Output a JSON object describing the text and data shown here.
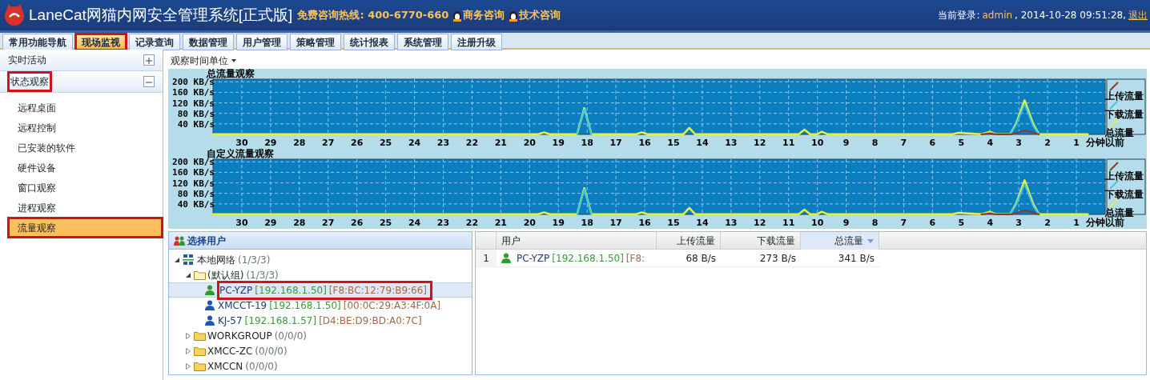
{
  "header": {
    "title": "LaneCat网猫内网安全管理系统[正式版]",
    "hotline": "免费咨询热线: 400-6770-660",
    "contacts": [
      "商务咨询",
      "技术咨询"
    ],
    "login_label": "当前登录:",
    "user": "admin",
    "datetime": ", 2014-10-28 09:51:28,",
    "logout": "退出"
  },
  "tabs": [
    {
      "label": "常用功能导航",
      "selected": false,
      "highlighted": false
    },
    {
      "label": "现场监视",
      "selected": true,
      "highlighted": true
    },
    {
      "label": "记录查询",
      "selected": false,
      "highlighted": false
    },
    {
      "label": "数据管理",
      "selected": false,
      "highlighted": false
    },
    {
      "label": "用户管理",
      "selected": false,
      "highlighted": false
    },
    {
      "label": "策略管理",
      "selected": false,
      "highlighted": false
    },
    {
      "label": "统计报表",
      "selected": false,
      "highlighted": false
    },
    {
      "label": "系统管理",
      "selected": false,
      "highlighted": false
    },
    {
      "label": "注册升级",
      "selected": false,
      "highlighted": false
    }
  ],
  "sidebar": {
    "sections": [
      {
        "title": "实时活动",
        "expanded": false,
        "highlighted": false
      },
      {
        "title": "状态观察",
        "expanded": true,
        "highlighted": true,
        "items": [
          {
            "label": "远程桌面",
            "selected": false,
            "highlighted": false
          },
          {
            "label": "远程控制",
            "selected": false,
            "highlighted": false
          },
          {
            "label": "已安装的软件",
            "selected": false,
            "highlighted": false
          },
          {
            "label": "硬件设备",
            "selected": false,
            "highlighted": false
          },
          {
            "label": "窗口观察",
            "selected": false,
            "highlighted": false
          },
          {
            "label": "进程观察",
            "selected": false,
            "highlighted": false
          },
          {
            "label": "流量观察",
            "selected": true,
            "highlighted": true
          }
        ]
      }
    ]
  },
  "toolbar": {
    "menu": "观察时间单位"
  },
  "charts": [
    {
      "chart_data": {
        "type": "line",
        "title": "总流量观察",
        "xlabel": "分钟以前",
        "xlim": [
          31,
          0
        ],
        "ylim": [
          0,
          210
        ],
        "grid": true,
        "legend": true,
        "xticks": [
          30,
          29,
          28,
          27,
          26,
          25,
          24,
          23,
          22,
          21,
          20,
          19,
          18,
          17,
          16,
          15,
          14,
          13,
          12,
          11,
          10,
          9,
          8,
          7,
          6,
          5,
          4,
          3,
          2,
          1
        ],
        "yticks": [
          {
            "value": 40,
            "label": "40 KB/s"
          },
          {
            "value": 80,
            "label": "80 KB/s"
          },
          {
            "value": 120,
            "label": "120 KB/s"
          },
          {
            "value": 160,
            "label": "160 KB/s"
          },
          {
            "value": 200,
            "label": "200 KB/s"
          }
        ],
        "x": [
          31,
          25,
          20,
          19.7,
          19.5,
          19.3,
          18.35,
          18.1,
          17.85,
          16.3,
          16.1,
          15.9,
          14.65,
          14.45,
          14.25,
          10.65,
          10.45,
          10.25,
          10.0,
          9.85,
          9.65,
          5.3,
          5.1,
          4.3,
          4.0,
          3.8,
          3.3,
          3.1,
          2.8,
          2.5,
          2.3,
          1,
          0.6
        ],
        "series": [
          {
            "name": "上传流量",
            "color": "#8b3a2a",
            "values": [
              null,
              null,
              null,
              null,
              null,
              null,
              null,
              null,
              null,
              null,
              null,
              null,
              null,
              null,
              null,
              null,
              null,
              null,
              null,
              null,
              null,
              null,
              null,
              0,
              5,
              0,
              0,
              5,
              15,
              8,
              0,
              null,
              null
            ]
          },
          {
            "name": "下载流量",
            "color": "#40c8e0",
            "values": [
              null,
              null,
              null,
              null,
              null,
              null,
              1,
              95,
              1,
              null,
              null,
              null,
              null,
              null,
              null,
              null,
              null,
              null,
              null,
              null,
              null,
              null,
              null,
              null,
              null,
              null,
              1,
              35,
              115,
              32,
              1,
              null,
              null
            ]
          },
          {
            "name": "总流量",
            "color": "#e8f040",
            "values": [
              1,
              1,
              1,
              1,
              8,
              1,
              1,
              100,
              1,
              1,
              8,
              1,
              1,
              25,
              1,
              1,
              18,
              1,
              1,
              10,
              1,
              1,
              6,
              1,
              10,
              1,
              1,
              40,
              130,
              40,
              1,
              1,
              1
            ]
          }
        ]
      }
    },
    {
      "chart_data": {
        "type": "line",
        "title": "自定义流量观察",
        "xlabel": "分钟以前",
        "xlim": [
          31,
          0
        ],
        "ylim": [
          0,
          210
        ],
        "grid": true,
        "legend": true,
        "xticks": [
          30,
          29,
          28,
          27,
          26,
          25,
          24,
          23,
          22,
          21,
          20,
          19,
          18,
          17,
          16,
          15,
          14,
          13,
          12,
          11,
          10,
          9,
          8,
          7,
          6,
          5,
          4,
          3,
          2,
          1
        ],
        "yticks": [
          {
            "value": 40,
            "label": "40 KB/s"
          },
          {
            "value": 80,
            "label": "80 KB/s"
          },
          {
            "value": 120,
            "label": "120 KB/s"
          },
          {
            "value": 160,
            "label": "160 KB/s"
          },
          {
            "value": 200,
            "label": "200 KB/s"
          }
        ],
        "x": [
          31,
          25,
          20,
          19.7,
          19.5,
          19.3,
          18.35,
          18.1,
          17.85,
          16.3,
          16.1,
          15.9,
          14.65,
          14.45,
          14.25,
          10.65,
          10.45,
          10.25,
          10.0,
          9.85,
          9.65,
          5.3,
          5.1,
          4.3,
          4.0,
          3.8,
          3.3,
          3.1,
          2.8,
          2.5,
          2.3,
          1,
          0.6
        ],
        "series": [
          {
            "name": "上传流量",
            "color": "#8b3a2a",
            "values": [
              null,
              null,
              null,
              null,
              null,
              null,
              null,
              null,
              null,
              null,
              null,
              null,
              null,
              null,
              null,
              null,
              null,
              null,
              null,
              null,
              null,
              null,
              null,
              0,
              5,
              0,
              0,
              5,
              15,
              8,
              0,
              null,
              null
            ]
          },
          {
            "name": "下载流量",
            "color": "#40c8e0",
            "values": [
              null,
              null,
              null,
              null,
              null,
              null,
              1,
              95,
              1,
              null,
              null,
              null,
              null,
              null,
              null,
              null,
              null,
              null,
              null,
              null,
              null,
              null,
              null,
              null,
              null,
              null,
              1,
              35,
              115,
              32,
              1,
              null,
              null
            ]
          },
          {
            "name": "总流量",
            "color": "#e8f040",
            "values": [
              1,
              1,
              1,
              1,
              8,
              1,
              1,
              100,
              1,
              1,
              8,
              1,
              1,
              25,
              1,
              1,
              18,
              1,
              1,
              10,
              1,
              1,
              6,
              1,
              10,
              1,
              1,
              40,
              130,
              40,
              1,
              1,
              1
            ]
          }
        ]
      }
    }
  ],
  "user_tree": {
    "title": "选择用户",
    "nodes": [
      {
        "kind": "network",
        "label": "本地网络",
        "count": "(1/3/3)",
        "expanded": true,
        "children": [
          {
            "kind": "group",
            "label": "(默认组)",
            "count": "(1/3/3)",
            "expanded": true,
            "children": [
              {
                "kind": "user",
                "label": "PC-YZP",
                "ip": "[192.168.1.50]",
                "mac": "[F8:BC:12:79:B9:66]",
                "online": true,
                "selected": true,
                "highlighted": true
              },
              {
                "kind": "user",
                "label": "XMCCT-19",
                "ip": "[192.168.1.50]",
                "mac": "[00:0C:29:A3:4F:0A]",
                "online": false,
                "selected": false,
                "highlighted": false
              },
              {
                "kind": "user",
                "label": "KJ-57",
                "ip": "[192.168.1.57]",
                "mac": "[D4:BE:D9:BD:A0:7C]",
                "online": false,
                "selected": false,
                "highlighted": false
              }
            ]
          },
          {
            "kind": "group",
            "label": "WORKGROUP",
            "count": "(0/0/0)",
            "expanded": false
          },
          {
            "kind": "group",
            "label": "XMCC-ZC",
            "count": "(0/0/0)",
            "expanded": false
          },
          {
            "kind": "group",
            "label": "XMCCN",
            "count": "(0/0/0)",
            "expanded": false
          }
        ]
      }
    ]
  },
  "table": {
    "columns": [
      {
        "label": "用户",
        "sorted": false
      },
      {
        "label": "上传流量",
        "sorted": false
      },
      {
        "label": "下载流量",
        "sorted": false
      },
      {
        "label": "总流量",
        "sorted": true
      }
    ],
    "rows": [
      {
        "index": "1",
        "user": "PC-YZP",
        "ip": "[192.168.1.50]",
        "mac": "[F8:",
        "online": true,
        "upload": "68 B/s",
        "download": "273 B/s",
        "total": "341 B/s"
      }
    ]
  }
}
